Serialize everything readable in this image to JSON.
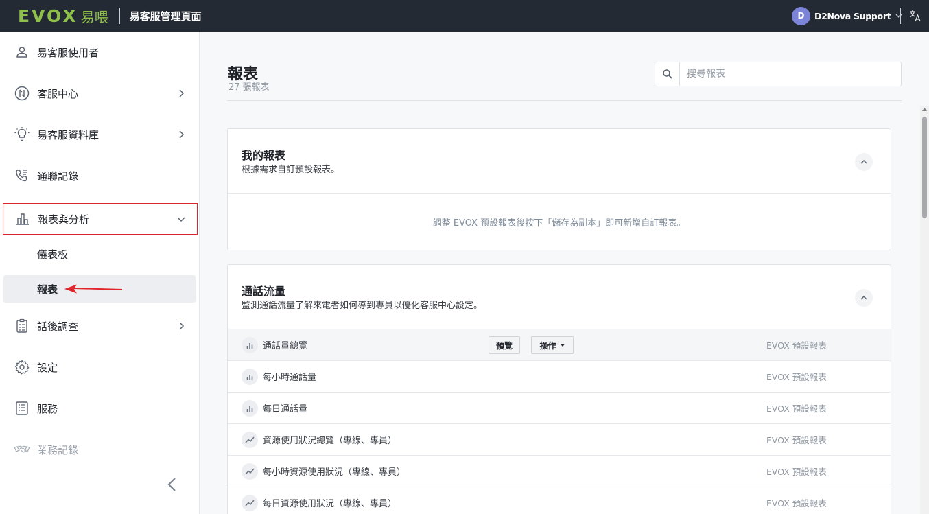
{
  "topbar": {
    "logo_text": "EVOX",
    "logo_cn": "易喂",
    "app_title": "易客服管理頁面",
    "user_initial": "D",
    "user_name": "D2Nova Support"
  },
  "sidebar": {
    "items": [
      {
        "label": "易客服使用者",
        "icon": "user-icon"
      },
      {
        "label": "客服中心",
        "icon": "call-center-icon"
      },
      {
        "label": "易客服資料庫",
        "icon": "lightbulb-icon"
      },
      {
        "label": "通聯記錄",
        "icon": "phone-log-icon"
      },
      {
        "label": "報表與分析",
        "icon": "bar-chart-icon"
      },
      {
        "label": "話後調查",
        "icon": "survey-icon"
      },
      {
        "label": "設定",
        "icon": "gear-icon"
      },
      {
        "label": "服務",
        "icon": "service-icon"
      },
      {
        "label": "業務記錄",
        "icon": "handshake-icon"
      }
    ],
    "sub_items": [
      {
        "label": "儀表板"
      },
      {
        "label": "報表"
      }
    ]
  },
  "main": {
    "title": "報表",
    "count": "27 張報表",
    "search_placeholder": "搜尋報表"
  },
  "my_reports": {
    "title": "我的報表",
    "subtitle": "根據需求自訂預設報表。",
    "empty": "調整 EVOX 預設報表後按下「儲存為副本」即可新增自訂報表。"
  },
  "call_traffic": {
    "title": "通話流量",
    "subtitle": "監測通話流量了解來電者如何導到專員以優化客服中心設定。",
    "preview_label": "預覽",
    "actions_label": "操作",
    "rows": [
      {
        "name": "通話量總覽",
        "source": "EVOX 預設報表",
        "icon": "bar-chart-icon"
      },
      {
        "name": "每小時通話量",
        "source": "EVOX 預設報表",
        "icon": "bar-chart-icon"
      },
      {
        "name": "每日通話量",
        "source": "EVOX 預設報表",
        "icon": "bar-chart-icon"
      },
      {
        "name": "資源使用狀況總覽（專線、專員）",
        "source": "EVOX 預設報表",
        "icon": "line-chart-icon"
      },
      {
        "name": "每小時資源使用狀況（專線、專員）",
        "source": "EVOX 預設報表",
        "icon": "line-chart-icon"
      },
      {
        "name": "每日資源使用狀況（專線、專員）",
        "source": "EVOX 預設報表",
        "icon": "line-chart-icon"
      }
    ]
  },
  "colors": {
    "topbar_bg": "#232a33",
    "brand_green": "#8fc14a",
    "active_border": "#d9262c",
    "arrow_red": "#e0262c"
  }
}
